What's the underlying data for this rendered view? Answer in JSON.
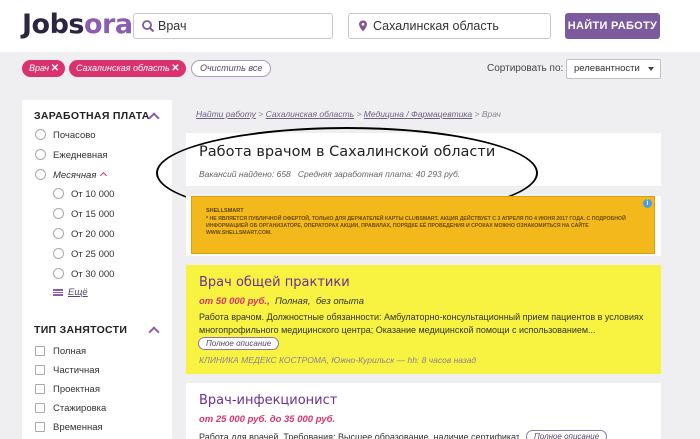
{
  "logo": {
    "part1": "Jobs",
    "part2": "ora"
  },
  "search": {
    "query": "Врач",
    "location": "Сахалинская область",
    "button": "НАЙТИ РАБОТУ"
  },
  "filters": {
    "chips": [
      "Врач",
      "Сахалинская область"
    ],
    "clear": "Очистить все",
    "sort_label": "Сортировать по:",
    "sort_value": "релевантности"
  },
  "sidebar": {
    "salary": {
      "title": "ЗАРАБОТНАЯ ПЛАТА",
      "options": [
        "Почасово",
        "Ежедневная",
        "Месячная"
      ],
      "sub_options": [
        "От 10 000",
        "От 15 000",
        "От 20 000",
        "От 25 000",
        "От 30 000"
      ],
      "more": "Ещё"
    },
    "employment": {
      "title": "ТИП ЗАНЯТОСТИ",
      "options": [
        "Полная",
        "Частичная",
        "Проектная",
        "Стажировка",
        "Временная"
      ]
    }
  },
  "breadcrumb": {
    "items": [
      "Найти работу",
      "Сахалинская область",
      "Медицина / Фармацевтика"
    ],
    "current": "Врач",
    "sep": ">"
  },
  "summary": {
    "title": "Работа врачом в Сахалинской области",
    "found_label": "Вакансий найдено:",
    "found_value": "658",
    "avg_label": "Средняя заработная плата:",
    "avg_value": "40 293 руб."
  },
  "ad": {
    "brand": "SHELLSMART",
    "text": "* НЕ ЯВЛЯЕТСЯ ПУБЛИЧНОЙ ОФЕРТОЙ, ТОЛЬКО ДЛЯ ДЕРЖАТЕЛЕЙ КАРТЫ CLUBSMART. АКЦИЯ ДЕЙСТВУЕТ С 3 АПРЕЛЯ ПО 4 ИЮНЯ 2017 ГОДА. С ПОДРОБНОЙ ИНФОРМАЦИЕЙ ОБ ОРГАНИЗАТОРЕ, ОПЕРАТОРАХ АКЦИИ, ПРАВИЛАХ, ПОРЯДКЕ ЕЁ ПРОВЕДЕНИЯ И СРОКАХ МОЖНО ОЗНАКОМИТЬСЯ НА САЙТЕ WWW.SHELLSMART.COM.",
    "info": "i"
  },
  "jobs": [
    {
      "title": "Врач общей практики",
      "salary": "от 50 000 руб.,",
      "employment": "Полная,",
      "experience": "без опыта",
      "desc": "Работа врачом. Должностные обязанности: Амбулаторно-консультационный прием пациентов в условиях многопрофильного медицинского центра; Оказание медицинской помощи с использованием...",
      "full": "Полное описание",
      "company": "КЛИНИКА МЕДЕКС КОСТРОМА, Южно-Курильск — hh: 8 часов назад"
    },
    {
      "title": "Врач-инфекционист",
      "salary": "от 25 000 руб. до 35 000 руб.",
      "desc": "Работа для врачей. Требования: Высшее образование, наличие сертификата",
      "full": "Полное описание"
    }
  ],
  "colors": {
    "accent": "#7b5a9e",
    "chip": "#d9326e",
    "highlight": "#f8f340"
  }
}
